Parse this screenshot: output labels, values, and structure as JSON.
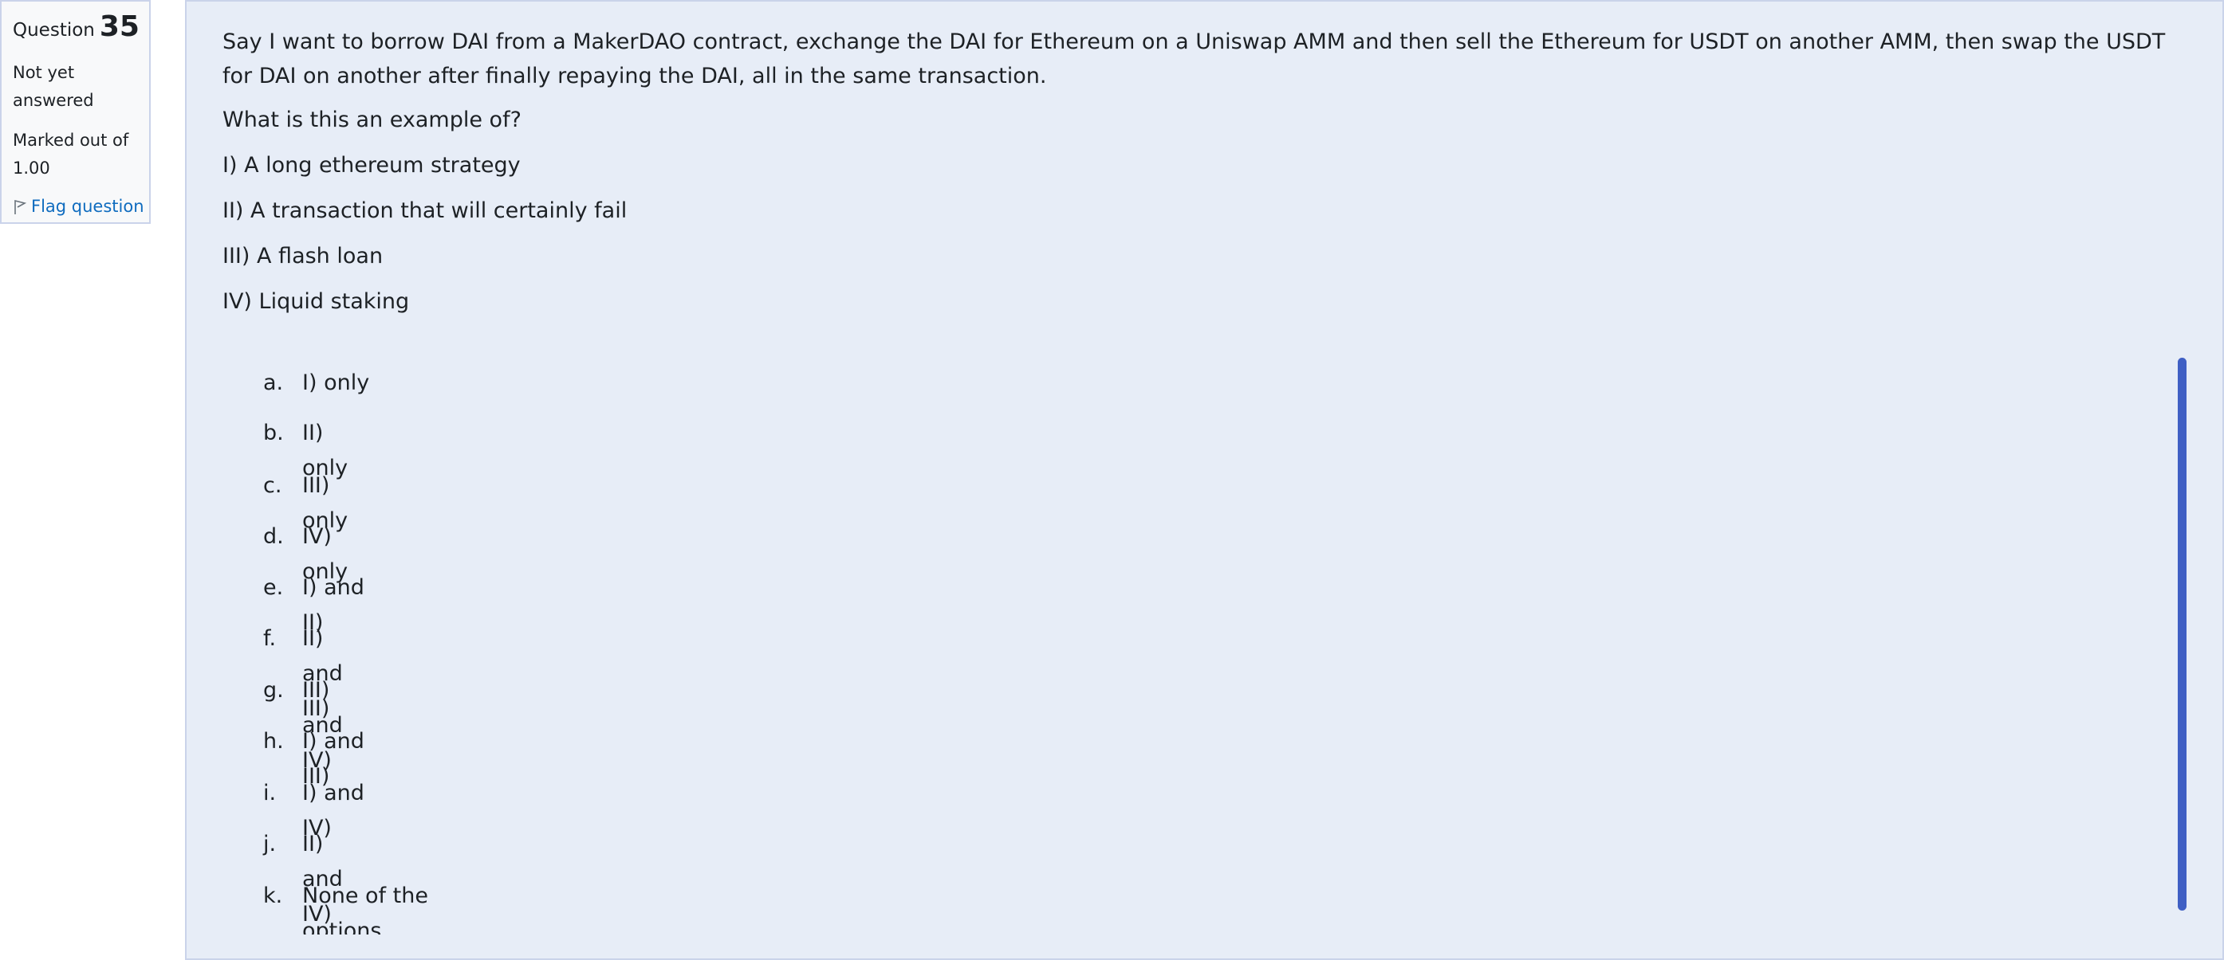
{
  "info": {
    "question_label": "Question",
    "question_number": "35",
    "state": "Not yet answered",
    "grade": "Marked out of 1.00",
    "flag_label": "Flag question"
  },
  "question": {
    "paragraph1": "Say I want to borrow DAI from a MakerDAO contract, exchange the DAI for Ethereum on a Uniswap AMM and then sell the Ethereum for USDT on another AMM, then swap the USDT for DAI on another after finally repaying the DAI, all in the same transaction.",
    "prompt": "What is this an example of?",
    "statements": [
      "I) A long ethereum strategy",
      "II) A transaction that will certainly fail",
      "III) A flash loan",
      "IV) Liquid staking"
    ]
  },
  "answers": [
    {
      "letter": "a.",
      "text": "I) only"
    },
    {
      "letter": "b.",
      "text": "II) only"
    },
    {
      "letter": "c.",
      "text": "III) only"
    },
    {
      "letter": "d.",
      "text": "IV) only"
    },
    {
      "letter": "e.",
      "text": "I) and II)"
    },
    {
      "letter": "f.",
      "text": "II) and III)"
    },
    {
      "letter": "g.",
      "text": "III) and IV)"
    },
    {
      "letter": "h.",
      "text": "I) and III)"
    },
    {
      "letter": "i.",
      "text": "I) and IV)"
    },
    {
      "letter": "j.",
      "text": "II) and IV)"
    },
    {
      "letter": "k.",
      "text": "None of the options"
    }
  ],
  "colors": {
    "panel_background": "#e7edf7",
    "info_background": "#f8f9fa",
    "border": "#cad3ea",
    "link": "#0f6cbf",
    "scrollbar": "#3f5fc4"
  },
  "icons": {
    "flag": "flag-icon"
  }
}
